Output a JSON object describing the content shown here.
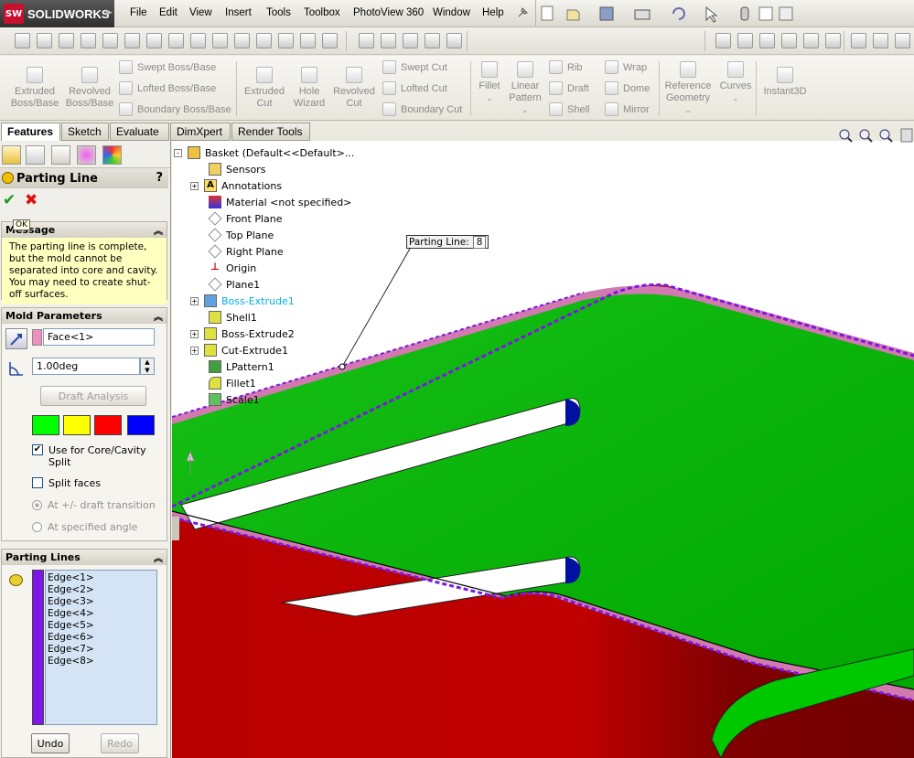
{
  "app": {
    "name": "SOLIDWORKS",
    "logo_text": "SW"
  },
  "menu": [
    "File",
    "Edit",
    "View",
    "Insert",
    "Tools",
    "Toolbox",
    "PhotoView 360",
    "Window",
    "Help"
  ],
  "command_manager": {
    "features": {
      "extruded_boss": "Extruded\nBoss/Base",
      "revolved_boss": "Revolved\nBoss/Base",
      "swept_boss": "Swept Boss/Base",
      "lofted_boss": "Lofted Boss/Base",
      "boundary_boss": "Boundary Boss/Base",
      "extruded_cut": "Extruded\nCut",
      "hole_wizard": "Hole\nWizard",
      "revolved_cut": "Revolved\nCut",
      "swept_cut": "Swept Cut",
      "lofted_cut": "Lofted Cut",
      "boundary_cut": "Boundary Cut",
      "fillet": "Fillet",
      "linear_pattern": "Linear\nPattern",
      "rib": "Rib",
      "draft": "Draft",
      "shell": "Shell",
      "wrap": "Wrap",
      "dome": "Dome",
      "mirror": "Mirror",
      "reference_geometry": "Reference\nGeometry",
      "curves": "Curves",
      "instant3d": "Instant3D"
    }
  },
  "tabs": [
    "Features",
    "Sketch",
    "Evaluate",
    "DimXpert",
    "Render Tools"
  ],
  "active_tab": "Features",
  "property_manager": {
    "title": "Parting Line",
    "help": "?",
    "ok_tooltip": "OK",
    "message": {
      "header": "Message",
      "text": "The parting line is complete, but the mold cannot be separated into core and cavity. You may need to create shut-off surfaces."
    },
    "mold_parameters": {
      "header": "Mold Parameters",
      "face_value": "Face<1>",
      "angle_value": "1.00deg",
      "draft_analysis": "Draft Analysis",
      "swatch_colors": [
        "#00ff00",
        "#ffff00",
        "#ff0000",
        "#0000ff"
      ],
      "use_core_cavity": "Use for Core/Cavity\nSplit",
      "use_core_cavity_checked": true,
      "split_faces": "Split faces",
      "split_faces_checked": false,
      "radio_draft_transition": "At +/- draft transition",
      "radio_specified_angle": "At specified angle"
    },
    "parting_lines": {
      "header": "Parting Lines",
      "edges": [
        "Edge<1>",
        "Edge<2>",
        "Edge<3>",
        "Edge<4>",
        "Edge<5>",
        "Edge<6>",
        "Edge<7>",
        "Edge<8>"
      ],
      "undo": "Undo",
      "redo": "Redo"
    }
  },
  "feature_tree": [
    {
      "label": "Basket  (Default<<Default>...",
      "expand": "-"
    },
    {
      "label": "Sensors",
      "expand": ""
    },
    {
      "label": "Annotations",
      "expand": "+"
    },
    {
      "label": "Material <not specified>",
      "expand": ""
    },
    {
      "label": "Front Plane",
      "expand": ""
    },
    {
      "label": "Top Plane",
      "expand": ""
    },
    {
      "label": "Right Plane",
      "expand": ""
    },
    {
      "label": "Origin",
      "expand": ""
    },
    {
      "label": "Plane1",
      "expand": ""
    },
    {
      "label": "Boss-Extrude1",
      "expand": "+"
    },
    {
      "label": "Shell1",
      "expand": ""
    },
    {
      "label": "Boss-Extrude2",
      "expand": "+"
    },
    {
      "label": "Cut-Extrude1",
      "expand": "+"
    },
    {
      "label": "LPattern1",
      "expand": ""
    },
    {
      "label": "Fillet1",
      "expand": ""
    },
    {
      "label": "Scale1",
      "expand": ""
    }
  ],
  "callout": {
    "label": "Parting Line:",
    "value": "8"
  },
  "colors": {
    "core_green": "#00c800",
    "cavity_red": "#b00000",
    "parting_purple": "#7d16e6",
    "rim_pink": "#d279b0",
    "highlight_cyan": "#00b0e8"
  }
}
